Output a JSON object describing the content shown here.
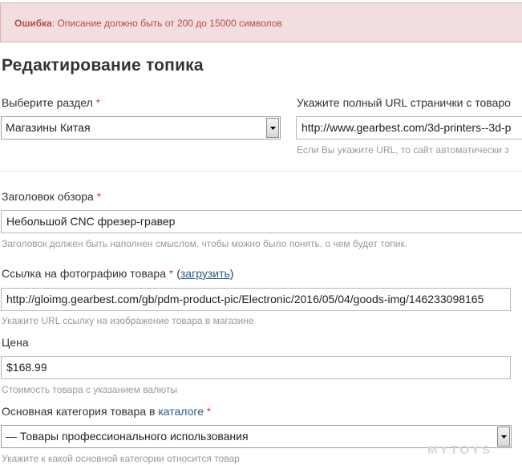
{
  "error": {
    "label": "Ошибка",
    "colon": ":",
    "message": "Описание должно быть от 200 до 15000 символов"
  },
  "page_title": "Редактирование топика",
  "section": {
    "label": "Выберите раздел",
    "required": "*",
    "selected": "Магазины Китая"
  },
  "url": {
    "label": "Укажите полный URL странички с товаро",
    "value": "http://www.gearbest.com/3d-printers--3d-p",
    "hint": "Если Вы укажите URL, то сайт автоматически з"
  },
  "review_title": {
    "label": "Заголовок обзора",
    "required": "*",
    "value": "Небольшой CNC фрезер-гравер",
    "hint": "Заголовок должен быть наполнен смыслом, чтобы можно было понять, о чем будет топик."
  },
  "photo": {
    "label": "Ссылка на фотографию товара",
    "required": "*",
    "open_paren": "(",
    "upload_link": "загрузить",
    "close_paren": ")",
    "value": "http://gloimg.gearbest.com/gb/pdm-product-pic/Electronic/2016/05/04/goods-img/146233098165",
    "hint": "Укажите URL ссылку на изображение товара в магазине"
  },
  "price": {
    "label": "Цена",
    "value": "$168.99",
    "hint": "Стоимость товара с указанием валюты"
  },
  "category": {
    "label_prefix": "Основная категория товара в",
    "catalog_link": "каталоге",
    "required": "*",
    "selected": "— Товары профессионального использования",
    "hint": "Укажите к какой основной категории относится товар"
  },
  "watermark": "MYTOYS",
  "colors": {
    "error_bg": "#f2dede",
    "error_text": "#b94a48",
    "required": "#d14836",
    "link": "#2a5885",
    "hint": "#999999"
  }
}
